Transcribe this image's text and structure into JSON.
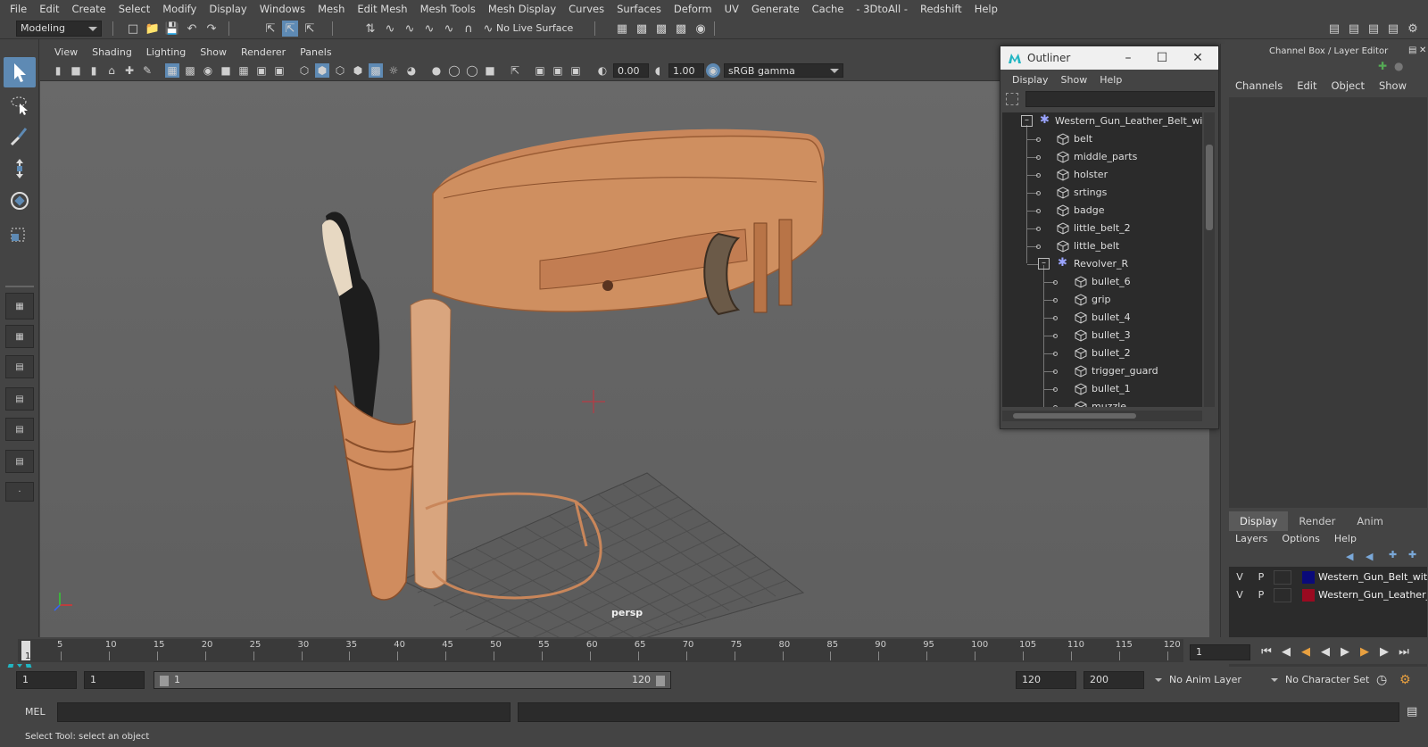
{
  "menubar": {
    "items": [
      "File",
      "Edit",
      "Create",
      "Select",
      "Modify",
      "Display",
      "Windows",
      "Mesh",
      "Edit Mesh",
      "Mesh Tools",
      "Mesh Display",
      "Curves",
      "Surfaces",
      "Deform",
      "UV",
      "Generate",
      "Cache",
      "- 3DtoAll -",
      "Redshift",
      "Help"
    ]
  },
  "statusline": {
    "mode": "Modeling",
    "live_surface": "No Live Surface"
  },
  "viewport": {
    "menu": [
      "View",
      "Shading",
      "Lighting",
      "Show",
      "Renderer",
      "Panels"
    ],
    "exposure": "0.00",
    "gamma": "1.00",
    "color_space": "sRGB gamma",
    "camera_label": "persp"
  },
  "outliner": {
    "title": "Outliner",
    "menu": [
      "Display",
      "Show",
      "Help"
    ],
    "items": [
      {
        "label": "Western_Gun_Leather_Belt_with",
        "type": "group"
      },
      {
        "label": "belt",
        "type": "mesh"
      },
      {
        "label": "middle_parts",
        "type": "mesh"
      },
      {
        "label": "holster",
        "type": "mesh"
      },
      {
        "label": "srtings",
        "type": "mesh"
      },
      {
        "label": "badge",
        "type": "mesh"
      },
      {
        "label": "little_belt_2",
        "type": "mesh"
      },
      {
        "label": "little_belt",
        "type": "mesh"
      },
      {
        "label": "Revolver_R",
        "type": "group"
      },
      {
        "label": "bullet_6",
        "type": "mesh"
      },
      {
        "label": "grip",
        "type": "mesh"
      },
      {
        "label": "bullet_4",
        "type": "mesh"
      },
      {
        "label": "bullet_3",
        "type": "mesh"
      },
      {
        "label": "bullet_2",
        "type": "mesh"
      },
      {
        "label": "trigger_guard",
        "type": "mesh"
      },
      {
        "label": "bullet_1",
        "type": "mesh"
      },
      {
        "label": "muzzle",
        "type": "mesh"
      }
    ]
  },
  "channelbox": {
    "title": "Channel Box / Layer Editor",
    "menu": [
      "Channels",
      "Edit",
      "Object",
      "Show"
    ],
    "tabs": [
      "Display",
      "Render",
      "Anim"
    ],
    "layer_menu": [
      "Layers",
      "Options",
      "Help"
    ],
    "layers": [
      {
        "v": "V",
        "p": "P",
        "color": "#0a0a7a",
        "name": "Western_Gun_Belt_with_"
      },
      {
        "v": "V",
        "p": "P",
        "color": "#9a0a20",
        "name": "Western_Gun_Leather_B"
      }
    ]
  },
  "timeline": {
    "ticks": [
      "5",
      "10",
      "15",
      "20",
      "25",
      "30",
      "35",
      "40",
      "45",
      "50",
      "55",
      "60",
      "65",
      "70",
      "75",
      "80",
      "85",
      "90",
      "95",
      "100",
      "105",
      "110",
      "115",
      "120"
    ],
    "current_marker": "1",
    "current_frame": "1"
  },
  "rangebar": {
    "start": "1",
    "playback_start": "1",
    "slider_start": "1",
    "slider_end": "120",
    "playback_end": "120",
    "end": "200",
    "anim_layer": "No Anim Layer",
    "character_set": "No Character Set"
  },
  "cmdline": {
    "label": "MEL"
  },
  "helpline": {
    "text": "Select Tool: select an object"
  }
}
